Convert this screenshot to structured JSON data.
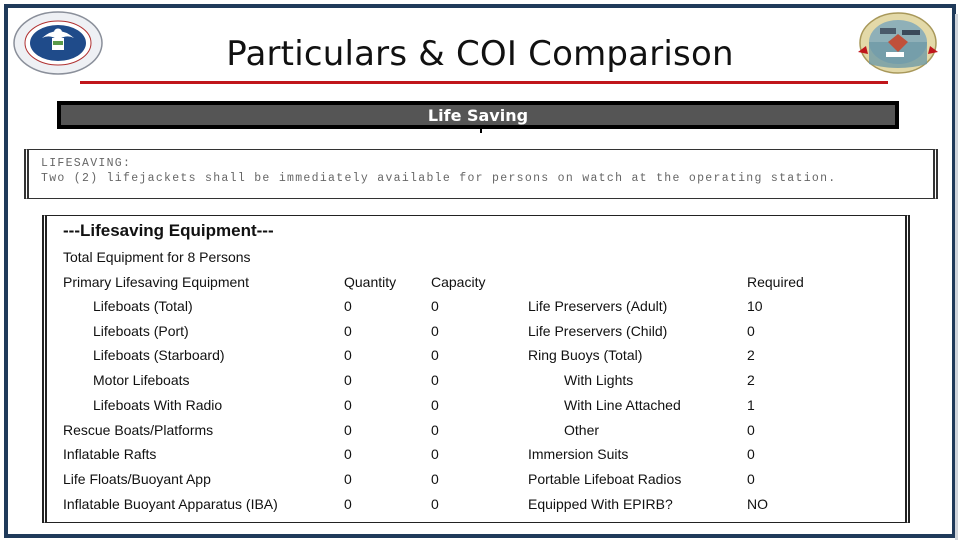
{
  "header": {
    "title": "Particulars & COI Comparison",
    "logo_left": "dhs-seal-icon",
    "logo_right": "coast-guard-sector-new-orleans-seal-icon",
    "accent_color": "#c0161b",
    "frame_color": "#1f3a5a"
  },
  "section": {
    "label": "Life Saving"
  },
  "coi": {
    "heading": "LIFESAVING:",
    "text": "Two (2) lifejackets shall be immediately available for persons on watch at the operating station."
  },
  "equipment": {
    "title": "---Lifesaving Equipment---",
    "subtitle": "Total Equipment for 8 Persons",
    "headers": {
      "primary": "Primary Lifesaving Equipment",
      "quantity": "Quantity",
      "capacity": "Capacity",
      "required": "Required"
    },
    "primary_rows": [
      {
        "label": "Lifeboats (Total)",
        "quantity": "0",
        "capacity": "0",
        "indent": true
      },
      {
        "label": "Lifeboats (Port)",
        "quantity": "0",
        "capacity": "0",
        "indent": true
      },
      {
        "label": "Lifeboats (Starboard)",
        "quantity": "0",
        "capacity": "0",
        "indent": true
      },
      {
        "label": "Motor Lifeboats",
        "quantity": "0",
        "capacity": "0",
        "indent": true
      },
      {
        "label": "Lifeboats With Radio",
        "quantity": "0",
        "capacity": "0",
        "indent": true
      },
      {
        "label": "Rescue Boats/Platforms",
        "quantity": "0",
        "capacity": "0",
        "indent": false
      },
      {
        "label": "Inflatable Rafts",
        "quantity": "0",
        "capacity": "0",
        "indent": false
      },
      {
        "label": "Life Floats/Buoyant App",
        "quantity": "0",
        "capacity": "0",
        "indent": false
      },
      {
        "label": "Inflatable Buoyant Apparatus (IBA)",
        "quantity": "0",
        "capacity": "0",
        "indent": false
      }
    ],
    "other_rows": [
      {
        "label": "Life Preservers (Adult)",
        "required": "10",
        "indent": false
      },
      {
        "label": "Life Preservers (Child)",
        "required": "0",
        "indent": false
      },
      {
        "label": "Ring Buoys (Total)",
        "required": "2",
        "indent": false
      },
      {
        "label": "With Lights",
        "required": "2",
        "indent": true
      },
      {
        "label": "With Line Attached",
        "required": "1",
        "indent": true
      },
      {
        "label": "Other",
        "required": "0",
        "indent": true
      },
      {
        "label": "Immersion Suits",
        "required": "0",
        "indent": false
      },
      {
        "label": "Portable Lifeboat Radios",
        "required": "0",
        "indent": false
      },
      {
        "label": "Equipped With EPIRB?",
        "required": "NO",
        "indent": false
      }
    ]
  }
}
